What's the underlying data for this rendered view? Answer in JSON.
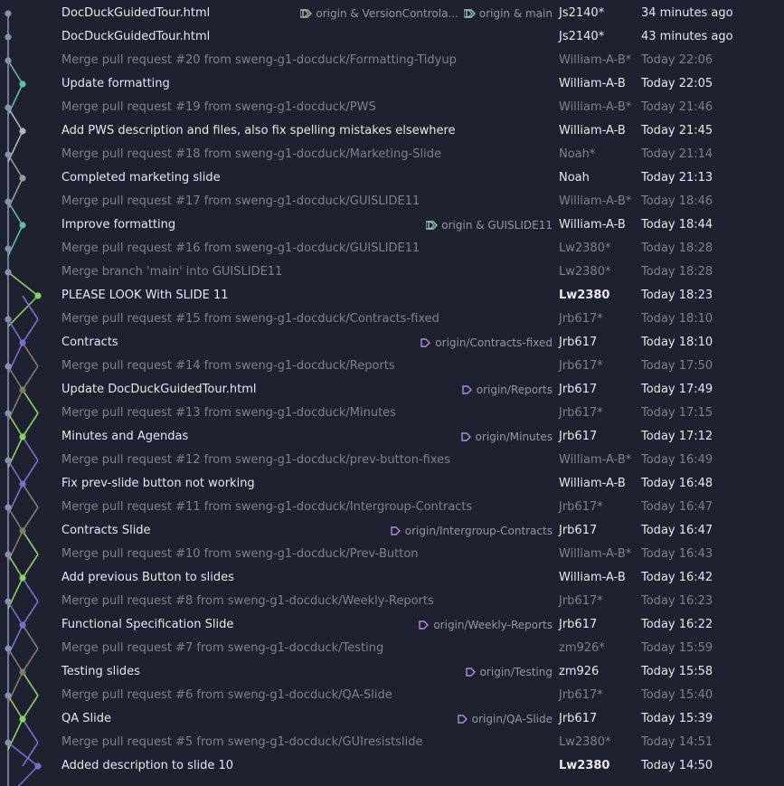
{
  "commits": [
    {
      "message": "DocDuckGuidedTour.html",
      "author": "Js2140*",
      "date": "34 minutes ago",
      "merge": false,
      "tags": [
        {
          "label": "origin & VersionControla...",
          "color": "#c9b26a",
          "icon": "tag-pair-icon"
        },
        {
          "label": "origin & main",
          "color": "#8fd4a0",
          "icon": "tag-pair-icon"
        }
      ]
    },
    {
      "message": "DocDuckGuidedTour.html",
      "author": "Js2140*",
      "date": "43 minutes ago",
      "merge": false,
      "tags": []
    },
    {
      "message": "Merge pull request #20 from sweng-g1-docduck/Formatting-Tidyup",
      "author": "William-A-B*",
      "date": "Today 22:06",
      "merge": true,
      "tags": []
    },
    {
      "message": "Update formatting",
      "author": "William-A-B",
      "date": "Today 22:05",
      "merge": false,
      "tags": []
    },
    {
      "message": "Merge pull request #19 from sweng-g1-docduck/PWS",
      "author": "William-A-B*",
      "date": "Today 21:46",
      "merge": true,
      "tags": []
    },
    {
      "message": "Add PWS description and files, also fix spelling mistakes elsewhere",
      "author": "William-A-B",
      "date": "Today 21:45",
      "merge": false,
      "tags": []
    },
    {
      "message": "Merge pull request #18 from sweng-g1-docduck/Marketing-Slide",
      "author": "Noah*",
      "date": "Today 21:14",
      "merge": true,
      "tags": []
    },
    {
      "message": "Completed marketing slide",
      "author": "Noah",
      "date": "Today 21:13",
      "merge": false,
      "tags": []
    },
    {
      "message": "Merge pull request #17 from sweng-g1-docduck/GUISLIDE11",
      "author": "William-A-B*",
      "date": "Today 18:46",
      "merge": true,
      "tags": []
    },
    {
      "message": "Improve formatting",
      "author": "William-A-B",
      "date": "Today 18:44",
      "merge": false,
      "tags": [
        {
          "label": "origin & GUISLIDE11",
          "color": "#8fd4a0",
          "icon": "tag-pair-icon"
        }
      ]
    },
    {
      "message": "Merge pull request #16 from sweng-g1-docduck/GUISLIDE11",
      "author": "Lw2380*",
      "date": "Today 18:28",
      "merge": true,
      "tags": []
    },
    {
      "message": "Merge branch 'main' into GUISLIDE11",
      "author": "Lw2380*",
      "date": "Today 18:28",
      "merge": true,
      "tags": []
    },
    {
      "message": "PLEASE LOOK With SLIDE 11",
      "author": "Lw2380",
      "date": "Today 18:23",
      "merge": false,
      "bold": true,
      "tags": []
    },
    {
      "message": "Merge pull request #15 from sweng-g1-docduck/Contracts-fixed",
      "author": "Jrb617*",
      "date": "Today 18:10",
      "merge": true,
      "tags": []
    },
    {
      "message": "Contracts",
      "author": "Jrb617",
      "date": "Today 18:10",
      "merge": false,
      "tags": [
        {
          "label": "origin/Contracts-fixed",
          "color": "#b08be0",
          "icon": "tag-icon"
        }
      ]
    },
    {
      "message": "Merge pull request #14 from sweng-g1-docduck/Reports",
      "author": "Jrb617*",
      "date": "Today 17:50",
      "merge": true,
      "tags": []
    },
    {
      "message": "Update DocDuckGuidedTour.html",
      "author": "Jrb617",
      "date": "Today 17:49",
      "merge": false,
      "tags": [
        {
          "label": "origin/Reports",
          "color": "#b08be0",
          "icon": "tag-icon"
        }
      ]
    },
    {
      "message": "Merge pull request #13 from sweng-g1-docduck/Minutes",
      "author": "Jrb617*",
      "date": "Today 17:15",
      "merge": true,
      "tags": []
    },
    {
      "message": "Minutes and Agendas",
      "author": "Jrb617",
      "date": "Today 17:12",
      "merge": false,
      "tags": [
        {
          "label": "origin/Minutes",
          "color": "#b08be0",
          "icon": "tag-icon"
        }
      ]
    },
    {
      "message": "Merge pull request #12 from sweng-g1-docduck/prev-button-fixes",
      "author": "William-A-B*",
      "date": "Today 16:49",
      "merge": true,
      "tags": []
    },
    {
      "message": "Fix prev-slide button not working",
      "author": "William-A-B",
      "date": "Today 16:48",
      "merge": false,
      "tags": []
    },
    {
      "message": "Merge pull request #11 from sweng-g1-docduck/Intergroup-Contracts",
      "author": "Jrb617*",
      "date": "Today 16:47",
      "merge": true,
      "tags": []
    },
    {
      "message": "Contracts Slide",
      "author": "Jrb617",
      "date": "Today 16:47",
      "merge": false,
      "tags": [
        {
          "label": "origin/Intergroup-Contracts",
          "color": "#b08be0",
          "icon": "tag-icon"
        }
      ]
    },
    {
      "message": "Merge pull request #10 from sweng-g1-docduck/Prev-Button",
      "author": "William-A-B*",
      "date": "Today 16:43",
      "merge": true,
      "tags": []
    },
    {
      "message": "Add previous Button to slides",
      "author": "William-A-B",
      "date": "Today 16:42",
      "merge": false,
      "tags": []
    },
    {
      "message": "Merge pull request #8 from sweng-g1-docduck/Weekly-Reports",
      "author": "Jrb617*",
      "date": "Today 16:23",
      "merge": true,
      "tags": []
    },
    {
      "message": "Functional Specification Slide",
      "author": "Jrb617",
      "date": "Today 16:22",
      "merge": false,
      "tags": [
        {
          "label": "origin/Weekly-Reports",
          "color": "#b08be0",
          "icon": "tag-icon"
        }
      ]
    },
    {
      "message": "Merge pull request #7 from sweng-g1-docduck/Testing",
      "author": "zm926*",
      "date": "Today 15:59",
      "merge": true,
      "tags": []
    },
    {
      "message": "Testing slides",
      "author": "zm926",
      "date": "Today 15:58",
      "merge": false,
      "tags": [
        {
          "label": "origin/Testing",
          "color": "#b08be0",
          "icon": "tag-icon"
        }
      ]
    },
    {
      "message": "Merge pull request #6 from sweng-g1-docduck/QA-Slide",
      "author": "Jrb617*",
      "date": "Today 15:40",
      "merge": true,
      "tags": []
    },
    {
      "message": "QA Slide",
      "author": "Jrb617",
      "date": "Today 15:39",
      "merge": false,
      "tags": [
        {
          "label": "origin/QA-Slide",
          "color": "#b08be0",
          "icon": "tag-icon"
        }
      ]
    },
    {
      "message": "Merge pull request #5 from sweng-g1-docduck/GUIresistslide",
      "author": "Lw2380*",
      "date": "Today 14:51",
      "merge": true,
      "tags": []
    },
    {
      "message": "Added description to slide 10",
      "author": "Lw2380",
      "date": "Today 14:50",
      "merge": false,
      "bold": true,
      "tags": []
    }
  ],
  "colors": {
    "main_lane": "#8a8fb0",
    "branch_lanes": [
      "#8bd06a",
      "#9a9a9a",
      "#7b6dc9",
      "#5dbdb0",
      "#7f7a6a",
      "#b0b6c8"
    ]
  }
}
